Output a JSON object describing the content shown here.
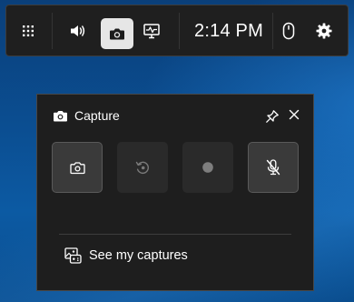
{
  "topbar": {
    "clock": "2:14 PM",
    "icons": [
      "apps-grid-icon",
      "audio-icon",
      "capture-icon",
      "performance-icon",
      "mouse-icon",
      "settings-icon"
    ],
    "selected_widget": "capture"
  },
  "capture_panel": {
    "title": "Capture",
    "buttons": [
      {
        "name": "screenshot",
        "icon": "camera-icon",
        "state": "enabled"
      },
      {
        "name": "record-last-30s",
        "icon": "replay-icon",
        "state": "disabled"
      },
      {
        "name": "start-recording",
        "icon": "record-dot-icon",
        "state": "disabled"
      },
      {
        "name": "microphone",
        "icon": "mic-off-icon",
        "state": "enabled"
      }
    ],
    "see_captures_label": "See my captures"
  },
  "colors": {
    "bar_bg": "#1f1f1f",
    "panel_bg": "#1e1e1e",
    "selected_bg": "#e6e6e6",
    "desktop_blue": "#0b4f93"
  }
}
